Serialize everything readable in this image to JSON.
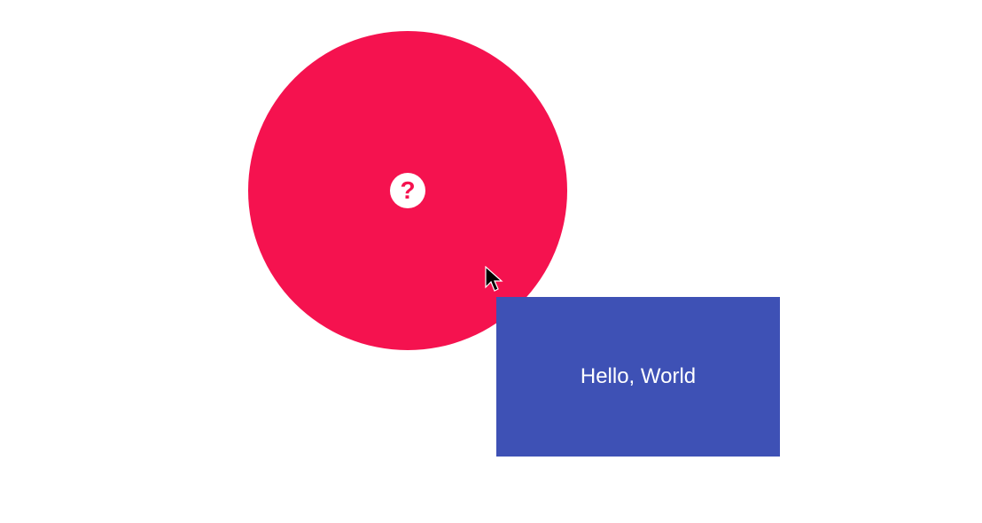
{
  "circle": {
    "help_glyph": "?",
    "color": "#f5124f"
  },
  "tooltip": {
    "text": "Hello, World",
    "color": "#3e51b5"
  }
}
